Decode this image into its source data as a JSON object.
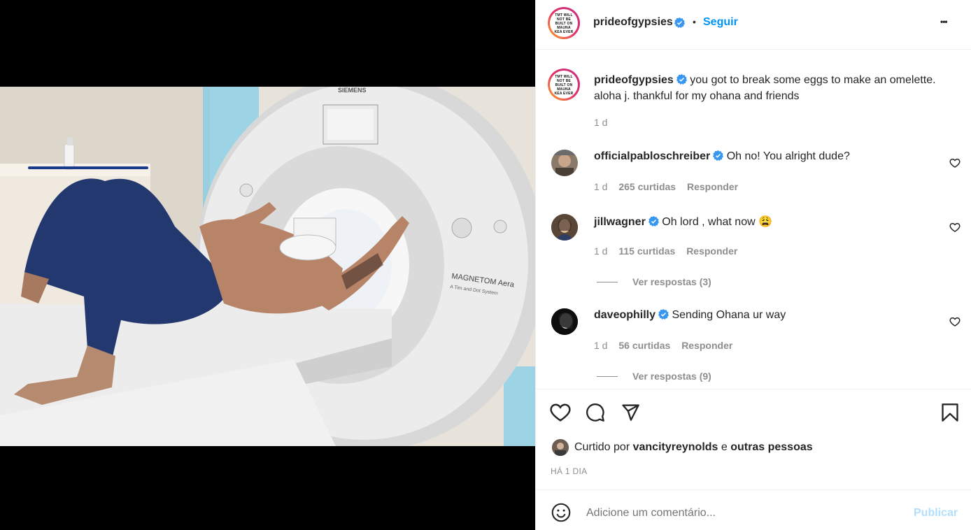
{
  "post": {
    "author": "prideofgypsies",
    "avatar_text": "TMT WILL NOT BE BUILT ON MAUNA KEA EVER",
    "follow_label": "Seguir",
    "separator": "•",
    "more_label": "•••",
    "caption": "you got to break some eggs to make an omelette. aloha j. thankful for my ohana and friends",
    "caption_time": "1 d",
    "photo_texts": {
      "brand": "SIEMENS",
      "model": "MAGNETOM Aera",
      "model_sub": "A Tim and Dot System"
    }
  },
  "comments": [
    {
      "user": "officialpabloschreiber",
      "text": "Oh no! You alright dude?",
      "time": "1 d",
      "likes": "265 curtidas",
      "reply": "Responder",
      "replies": ""
    },
    {
      "user": "jillwagner",
      "text": "Oh lord , what now 😩",
      "time": "1 d",
      "likes": "115 curtidas",
      "reply": "Responder",
      "replies": "Ver respostas (3)"
    },
    {
      "user": "daveophilly",
      "text": "Sending Ohana ur way",
      "time": "1 d",
      "likes": "56 curtidas",
      "reply": "Responder",
      "replies": "Ver respostas (9)"
    }
  ],
  "likes": {
    "prefix": "Curtido por",
    "user": "vancityreynolds",
    "conj": "e",
    "others": "outras pessoas"
  },
  "timestamp": "HÁ 1 DIA",
  "composer": {
    "placeholder": "Adicione um comentário...",
    "publish_label": "Publicar"
  },
  "colors": {
    "accent": "#0095f6",
    "verified": "#3897f0",
    "muted": "#8e8e8e",
    "publish_disabled": "#b2dffc"
  },
  "icons": [
    "verified-badge-icon",
    "more-options-icon",
    "heart-icon",
    "comment-icon",
    "share-icon",
    "bookmark-icon",
    "emoji-icon"
  ]
}
